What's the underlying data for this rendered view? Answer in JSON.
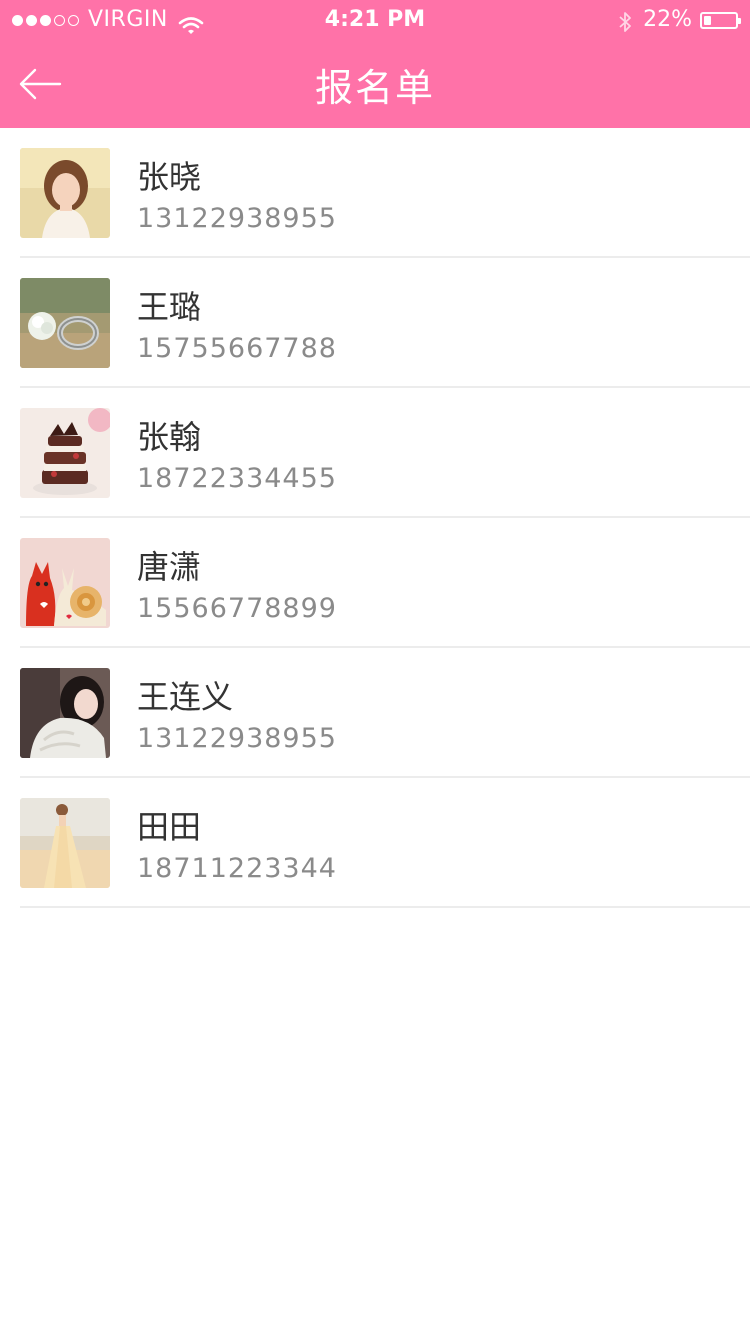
{
  "status_bar": {
    "carrier": "VIRGIN",
    "signal_icon": "signal-dots-icon",
    "signal_strength": 3,
    "signal_max": 5,
    "wifi_icon": "wifi-icon",
    "time": "4:21 PM",
    "bluetooth_icon": "bluetooth-icon",
    "battery_percent_text": "22%",
    "battery_level": 0.22
  },
  "nav": {
    "back_icon": "back-arrow-icon",
    "title": "报名单"
  },
  "colors": {
    "header": "#ff72a8",
    "name_text": "#333333",
    "phone_text": "#8a8a8a",
    "divider": "#ececec"
  },
  "registrants": [
    {
      "name": "张晓",
      "phone": "13122938955",
      "avatar": "woman-portrait-avatar"
    },
    {
      "name": "王璐",
      "phone": "15755667788",
      "avatar": "ring-flower-avatar"
    },
    {
      "name": "张翰",
      "phone": "18722334455",
      "avatar": "cake-avatar"
    },
    {
      "name": "唐潇",
      "phone": "15566778899",
      "avatar": "snail-toys-avatar"
    },
    {
      "name": "王连义",
      "phone": "13122938955",
      "avatar": "girl-sweater-avatar"
    },
    {
      "name": "田田",
      "phone": "18711223344",
      "avatar": "beach-dress-avatar"
    }
  ]
}
